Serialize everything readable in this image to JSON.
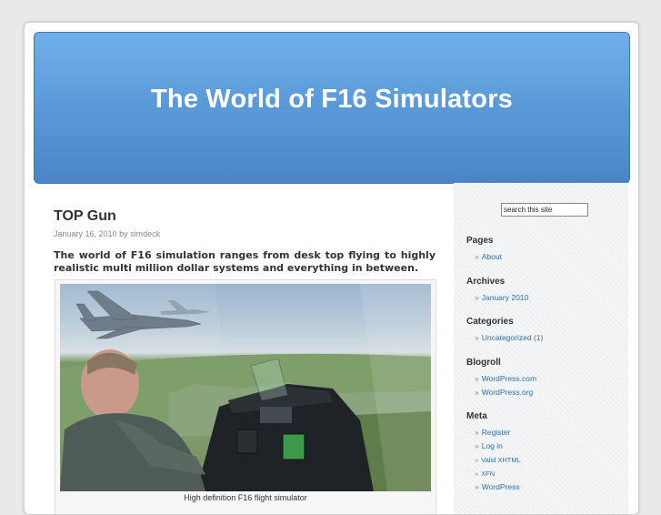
{
  "site": {
    "title": "The World of F16 Simulators"
  },
  "post": {
    "title": "TOP Gun",
    "date": "January 16, 2010",
    "by": "by",
    "author": "simdeck",
    "intro": "The world of F16 simulation ranges from desk top flying to highly realistic multi million dollar systems and everything in between.",
    "image_caption": "High definition F16 flight simulator"
  },
  "sidebar": {
    "search": {
      "value": "search this site"
    },
    "pages": {
      "title": "Pages",
      "items": [
        {
          "label": "About"
        }
      ]
    },
    "archives": {
      "title": "Archives",
      "items": [
        {
          "label": "January 2010"
        }
      ]
    },
    "categories": {
      "title": "Categories",
      "items": [
        {
          "label": "Uncategorized",
          "count": "(1)"
        }
      ]
    },
    "blogroll": {
      "title": "Blogroll",
      "items": [
        {
          "label": "WordPress.com"
        },
        {
          "label": "WordPress.org"
        }
      ]
    },
    "meta": {
      "title": "Meta",
      "items": [
        {
          "label": "Register"
        },
        {
          "label": "Log in"
        },
        {
          "label": "Valid XHTML"
        },
        {
          "label": "XFN"
        },
        {
          "label": "WordPress"
        }
      ]
    }
  },
  "colors": {
    "header": "#5b9bd9",
    "link": "#2e6fb5"
  }
}
